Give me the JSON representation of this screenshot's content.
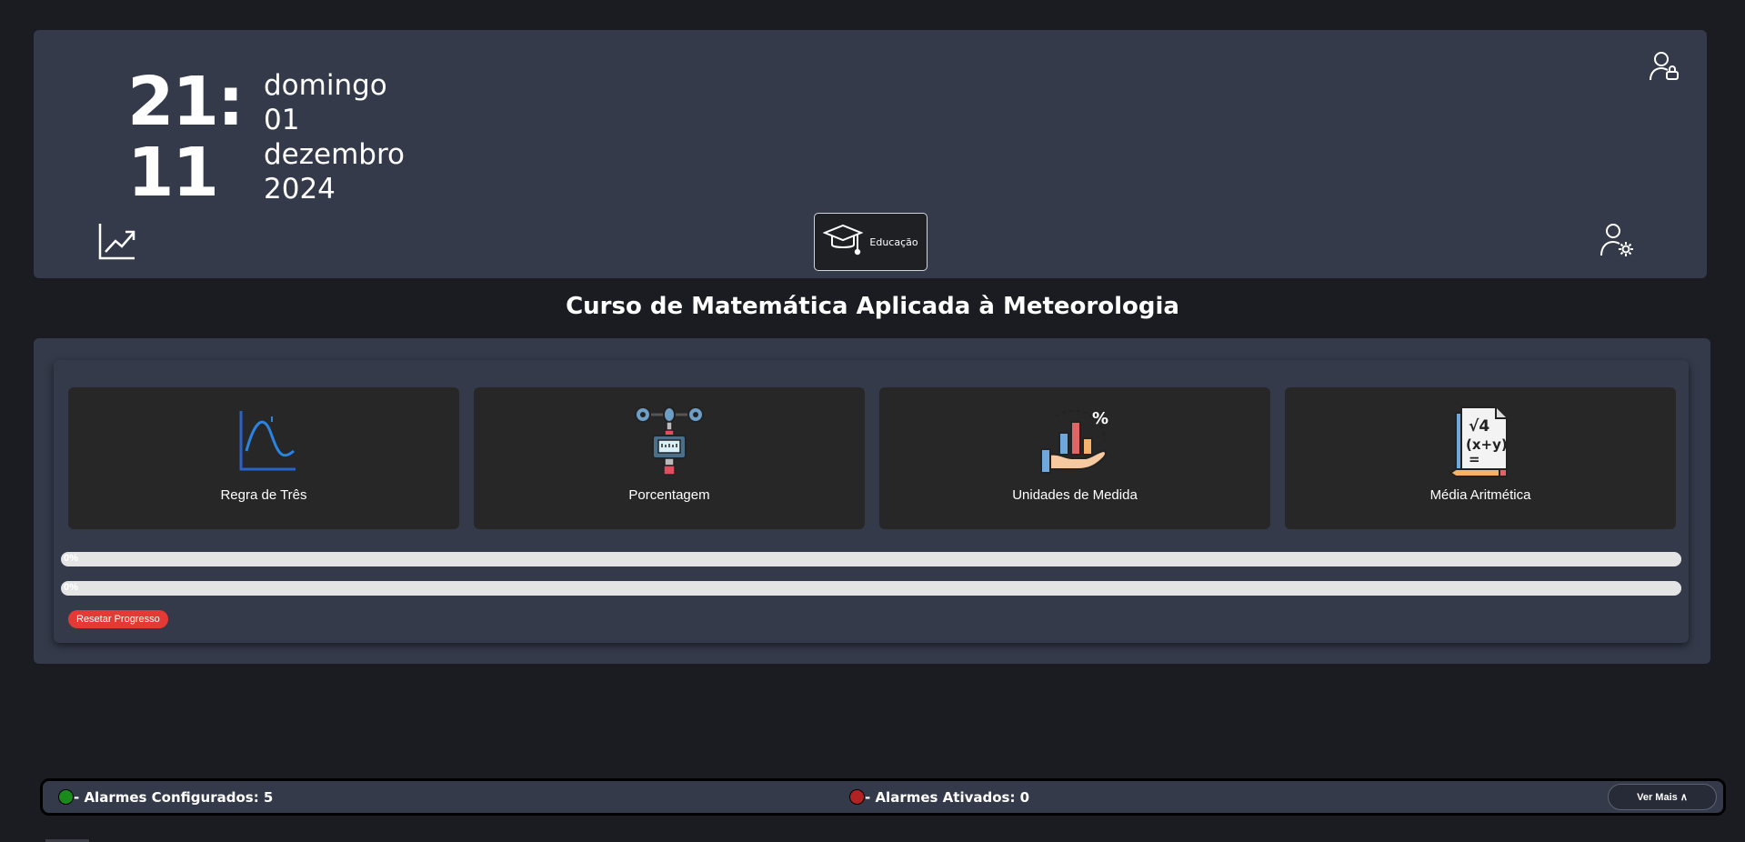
{
  "header": {
    "clock_hours": "21:",
    "clock_minutes": "11",
    "weekday": "domingo",
    "day": "01",
    "month": "dezembro",
    "year": "2024",
    "education_label": "Educação"
  },
  "page_title": "Curso de Matemática Aplicada à Meteorologia",
  "cards": [
    {
      "label": "Regra de Três",
      "icon": "sine-wave-graph-icon"
    },
    {
      "label": "Porcentagem",
      "icon": "anemometer-icon"
    },
    {
      "label": "Unidades de Medida",
      "icon": "hand-bar-chart-percent-icon"
    },
    {
      "label": "Média Aritmética",
      "icon": "formula-sheet-icon"
    }
  ],
  "progress": [
    {
      "text": "0%",
      "value": 0
    },
    {
      "text": "0%",
      "value": 0
    }
  ],
  "reset_label": "Resetar Progresso",
  "footer": {
    "configured_label": "- Alarmes Configurados: 5",
    "active_label": "- Alarmes Ativados: 0",
    "more_label": "Ver Mais ∧",
    "configured_color": "#1a8a1a",
    "active_color": "#b22222"
  }
}
